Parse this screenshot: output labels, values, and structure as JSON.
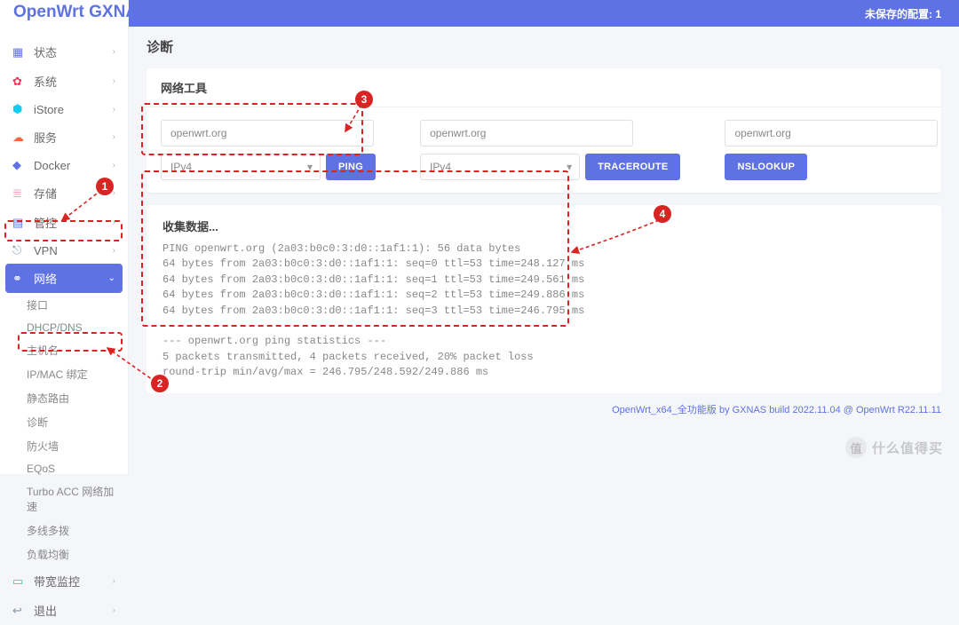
{
  "header": {
    "logo": "OpenWrt GXNAS",
    "unsaved": "未保存的配置: 1"
  },
  "sidebar": {
    "items": [
      {
        "icon": "▦",
        "cls": "c-blue",
        "label": "状态"
      },
      {
        "icon": "✿",
        "cls": "c-red",
        "label": "系统"
      },
      {
        "icon": "⬢",
        "cls": "c-cyan",
        "label": "iStore"
      },
      {
        "icon": "☁",
        "cls": "c-orange",
        "label": "服务"
      },
      {
        "icon": "◆",
        "cls": "c-blue",
        "label": "Docker"
      },
      {
        "icon": "≣",
        "cls": "c-pink",
        "label": "存储"
      },
      {
        "icon": "▤",
        "cls": "c-blue",
        "label": "管控"
      },
      {
        "icon": "⎋",
        "cls": "c-gray",
        "label": "VPN"
      },
      {
        "icon": "⚭",
        "cls": "",
        "label": "网络",
        "active": true
      }
    ],
    "sub": [
      "接口",
      "DHCP/DNS",
      "主机名",
      "IP/MAC 绑定",
      "静态路由",
      "诊断",
      "防火墙",
      "EQoS",
      "Turbo ACC 网络加速",
      "多线多拨",
      "负载均衡"
    ],
    "tail": [
      {
        "icon": "▭",
        "cls": "c-teal",
        "label": "带宽监控"
      },
      {
        "icon": "↩",
        "cls": "c-gray",
        "label": "退出"
      }
    ]
  },
  "main": {
    "title": "诊断",
    "tools_title": "网络工具",
    "col1": {
      "host": "openwrt.org",
      "proto": "IPv4",
      "btn": "PING"
    },
    "col2": {
      "host": "openwrt.org",
      "proto": "IPv4",
      "btn": "TRACEROUTE"
    },
    "col3": {
      "host": "openwrt.org",
      "btn": "NSLOOKUP"
    },
    "results_title": "收集数据...",
    "console": "PING openwrt.org (2a03:b0c0:3:d0::1af1:1): 56 data bytes\n64 bytes from 2a03:b0c0:3:d0::1af1:1: seq=0 ttl=53 time=248.127 ms\n64 bytes from 2a03:b0c0:3:d0::1af1:1: seq=1 ttl=53 time=249.561 ms\n64 bytes from 2a03:b0c0:3:d0::1af1:1: seq=2 ttl=53 time=249.886 ms\n64 bytes from 2a03:b0c0:3:d0::1af1:1: seq=3 ttl=53 time=246.795 ms\n\n--- openwrt.org ping statistics ---\n5 packets transmitted, 4 packets received, 20% packet loss\nround-trip min/avg/max = 246.795/248.592/249.886 ms",
    "footer": "OpenWrt_x64_全功能版 by GXNAS build 2022.11.04 @ OpenWrt R22.11.11"
  },
  "annotations": {
    "b1": "1",
    "b2": "2",
    "b3": "3",
    "b4": "4"
  },
  "watermark": {
    "char": "值",
    "text": "什么值得买"
  }
}
